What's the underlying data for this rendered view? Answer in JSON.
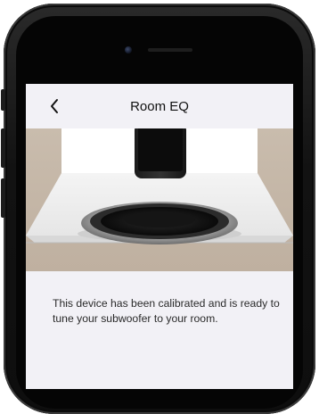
{
  "nav": {
    "title": "Room EQ",
    "back_icon": "chevron-left-icon"
  },
  "hero": {
    "description": "Illustration of a phone held above a subwoofer inside a room"
  },
  "content": {
    "message": "This device has been calibrated and is ready to tune your subwoofer to your room."
  },
  "colors": {
    "screen_background": "#f2f1f6",
    "room_wall": "#c7b8a8",
    "room_inner": "#ffffff",
    "text": "#2a2a2a"
  }
}
